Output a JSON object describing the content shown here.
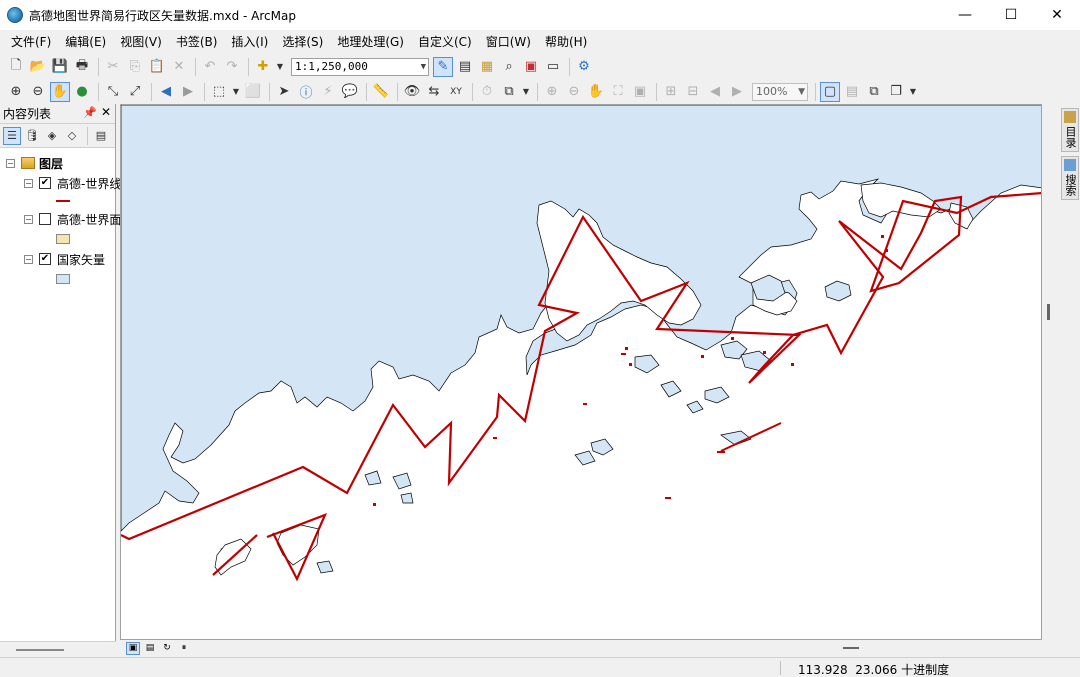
{
  "window": {
    "title": "高德地图世界简易行政区矢量数据.mxd - ArcMap",
    "minimize": "—",
    "maximize": "☐",
    "close": "✕"
  },
  "menu": [
    "文件(F)",
    "编辑(E)",
    "视图(V)",
    "书签(B)",
    "插入(I)",
    "选择(S)",
    "地理处理(G)",
    "自定义(C)",
    "窗口(W)",
    "帮助(H)"
  ],
  "toolbar": {
    "scale": "1:1,250,000",
    "zoom_percent": "100%"
  },
  "toc": {
    "title": "内容列表",
    "root": "图层",
    "layers": [
      {
        "name": "高德-世界线",
        "checked": true,
        "symbol": "line",
        "color": "#c00000"
      },
      {
        "name": "高德-世界面",
        "checked": false,
        "symbol": "polygon",
        "color": "#f5e6b0"
      },
      {
        "name": "国家矢量",
        "checked": true,
        "symbol": "polygon",
        "color": "#d4e6f5"
      }
    ]
  },
  "dock": {
    "catalog": "目录",
    "search": "搜索"
  },
  "status": {
    "x": "113.928",
    "y": "23.066",
    "units": "十进制度"
  },
  "colors": {
    "water": "#d4e6f5",
    "boundary": "#c00000",
    "coast": "#000000"
  }
}
